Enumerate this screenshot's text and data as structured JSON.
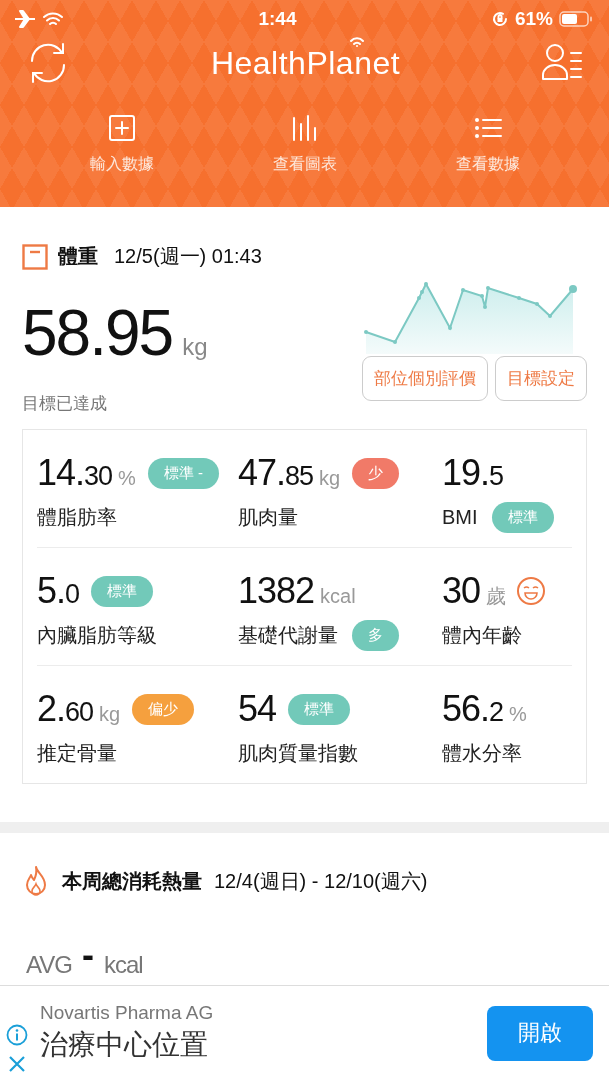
{
  "status_bar": {
    "time": "1:44",
    "battery": "61%"
  },
  "header": {
    "title": "HealthPlanet"
  },
  "nav": [
    {
      "label": "輸入數據"
    },
    {
      "label": "查看圖表"
    },
    {
      "label": "查看數據"
    }
  ],
  "weight": {
    "title": "體重",
    "date": "12/5(週一) 01:43",
    "value": "58.95",
    "unit": "kg",
    "goal_status": "目標已達成",
    "buttons": [
      "部位個別評價",
      "目標設定"
    ]
  },
  "metrics": [
    {
      "kind": "badge-value",
      "value": "14.30",
      "unit": "%",
      "badge": "標準 -",
      "color": "#72c9b9",
      "label": "體脂肪率"
    },
    {
      "kind": "badge-value",
      "value": "47.85",
      "unit": "kg",
      "badge": "少",
      "color": "#f17a68",
      "label": "肌肉量"
    },
    {
      "kind": "badge-label",
      "value": "19.5",
      "badge": "標準",
      "color": "#72c9b9",
      "label": "BMI"
    },
    {
      "kind": "badge-value",
      "value": "5.0",
      "badge": "標準",
      "color": "#72c9b9",
      "label": "內臟脂肪等級"
    },
    {
      "kind": "badge-label",
      "value": "1382",
      "unit": "kcal",
      "badge": "多",
      "color": "#72c9b9",
      "label": "基礎代謝量"
    },
    {
      "kind": "face",
      "value": "30",
      "unit": "歲",
      "label": "體內年齡"
    },
    {
      "kind": "badge-value",
      "value": "2.60",
      "unit": "kg",
      "badge": "偏少",
      "color": "#f5a03e",
      "label": "推定骨量"
    },
    {
      "kind": "badge-value",
      "value": "54",
      "badge": "標準",
      "color": "#72c9b9",
      "label": "肌肉質量指數"
    },
    {
      "kind": "plain",
      "value": "56.2",
      "unit": "%",
      "label": "體水分率"
    }
  ],
  "calories": {
    "title": "本周總消耗熱量",
    "range": "12/4(週日) - 12/10(週六)",
    "avg_label": "AVG",
    "avg_value": "-",
    "unit": "kcal"
  },
  "ad": {
    "advertiser": "Novartis Pharma AG",
    "headline": "治療中心位置",
    "button": "開啟"
  }
}
